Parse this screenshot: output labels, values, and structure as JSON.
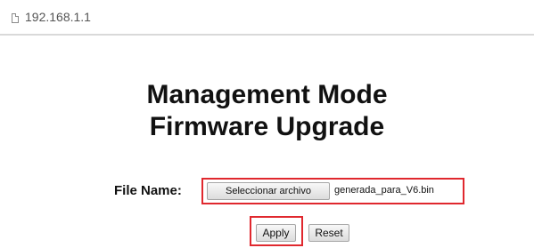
{
  "browser": {
    "url": "192.168.1.1",
    "page_icon": "page-icon"
  },
  "page": {
    "title_line1": "Management Mode",
    "title_line2": "Firmware Upgrade"
  },
  "form": {
    "file_label": "File Name:",
    "choose_file_label": "Seleccionar archivo",
    "selected_file": "generada_para_V6.bin",
    "apply_label": "Apply",
    "reset_label": "Reset"
  },
  "colors": {
    "highlight": "#e0282e"
  }
}
